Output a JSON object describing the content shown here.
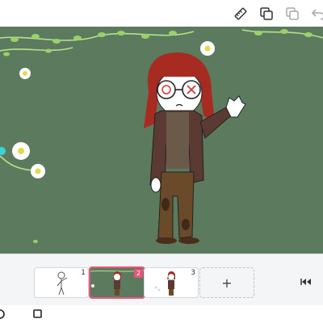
{
  "toolbar": {
    "icons": [
      "ruler-icon",
      "duplicate-layer-icon",
      "copy-icon",
      "undo-icon"
    ]
  },
  "timeline": {
    "frames": [
      {
        "number": "1",
        "active": false
      },
      {
        "number": "2",
        "active": true
      },
      {
        "number": "3",
        "active": false
      }
    ],
    "add_label": "+"
  },
  "navbar": {
    "icons": [
      "home-circle-icon",
      "recents-square-icon"
    ]
  },
  "colors": {
    "canvas_bg": "#5c7a5e",
    "accent": "#e9557b"
  }
}
